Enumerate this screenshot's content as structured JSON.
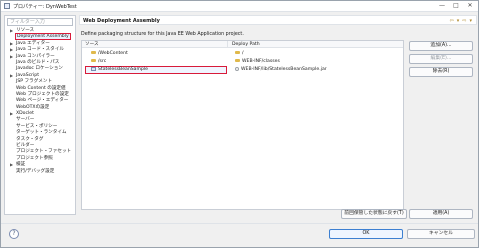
{
  "window": {
    "title": "プロパティー: DynWebTest",
    "controls": {
      "minimize": "—",
      "maximize": "□",
      "close": "✕"
    }
  },
  "left": {
    "filter_placeholder": "フィルター入力",
    "tree": [
      {
        "label": "リソース",
        "expander": "▶"
      },
      {
        "label": "Deployment Assembly",
        "expander": "",
        "selected": true
      },
      {
        "label": "Java エディター",
        "expander": "▶"
      },
      {
        "label": "Java コード・スタイル",
        "expander": "▶"
      },
      {
        "label": "Java コンパイラー",
        "expander": "▶"
      },
      {
        "label": "Java のビルド・パス",
        "expander": ""
      },
      {
        "label": "Javadoc ロケーション",
        "expander": ""
      },
      {
        "label": "JavaScript",
        "expander": "▶"
      },
      {
        "label": "JSP フラグメント",
        "expander": ""
      },
      {
        "label": "Web Content の設定値",
        "expander": ""
      },
      {
        "label": "Web プロジェクトの設定",
        "expander": ""
      },
      {
        "label": "Web ページ・エディター",
        "expander": ""
      },
      {
        "label": "WebOTXの設定",
        "expander": ""
      },
      {
        "label": "XDoclet",
        "expander": "▶"
      },
      {
        "label": "サーバー",
        "expander": ""
      },
      {
        "label": "サービス・ポリシー",
        "expander": ""
      },
      {
        "label": "ターゲット・ランタイム",
        "expander": ""
      },
      {
        "label": "タスク・タグ",
        "expander": ""
      },
      {
        "label": "ビルダー",
        "expander": ""
      },
      {
        "label": "プロジェクト・ファセット",
        "expander": ""
      },
      {
        "label": "プロジェクト参照",
        "expander": ""
      },
      {
        "label": "検証",
        "expander": "▶"
      },
      {
        "label": "実行/デバッグ設定",
        "expander": ""
      }
    ]
  },
  "main": {
    "title": "Web Deployment Assembly",
    "nav": {
      "back": "⇦",
      "back_menu": "▾",
      "forward": "⇨",
      "forward_menu": "▾"
    },
    "description": "Define packaging structure for this Java EE Web Application project.",
    "table": {
      "headers": {
        "source": "ソース",
        "deploy": "Deploy Path"
      },
      "rows": [
        {
          "source": "/WebContent",
          "deploy": "/",
          "src_icon": "folder-icon",
          "dep_icon": "folder-icon"
        },
        {
          "source": "/src",
          "deploy": "WEB-INF/classes",
          "src_icon": "folder-icon",
          "dep_icon": "folder-icon"
        },
        {
          "source": "StatelessBeanSample",
          "deploy": "WEB-INF/lib/StatelessBeanSample.jar",
          "src_icon": "project-icon",
          "dep_icon": "jar-icon",
          "selected": true
        }
      ]
    },
    "buttons": {
      "add": "追加(A)...",
      "edit": "編集(E)...",
      "remove": "除去(R)",
      "restore": "前回保管した状態に戻す(T)",
      "apply": "適用(A)"
    }
  },
  "footer": {
    "help": "?",
    "ok": "OK",
    "cancel": "キャンセル"
  }
}
